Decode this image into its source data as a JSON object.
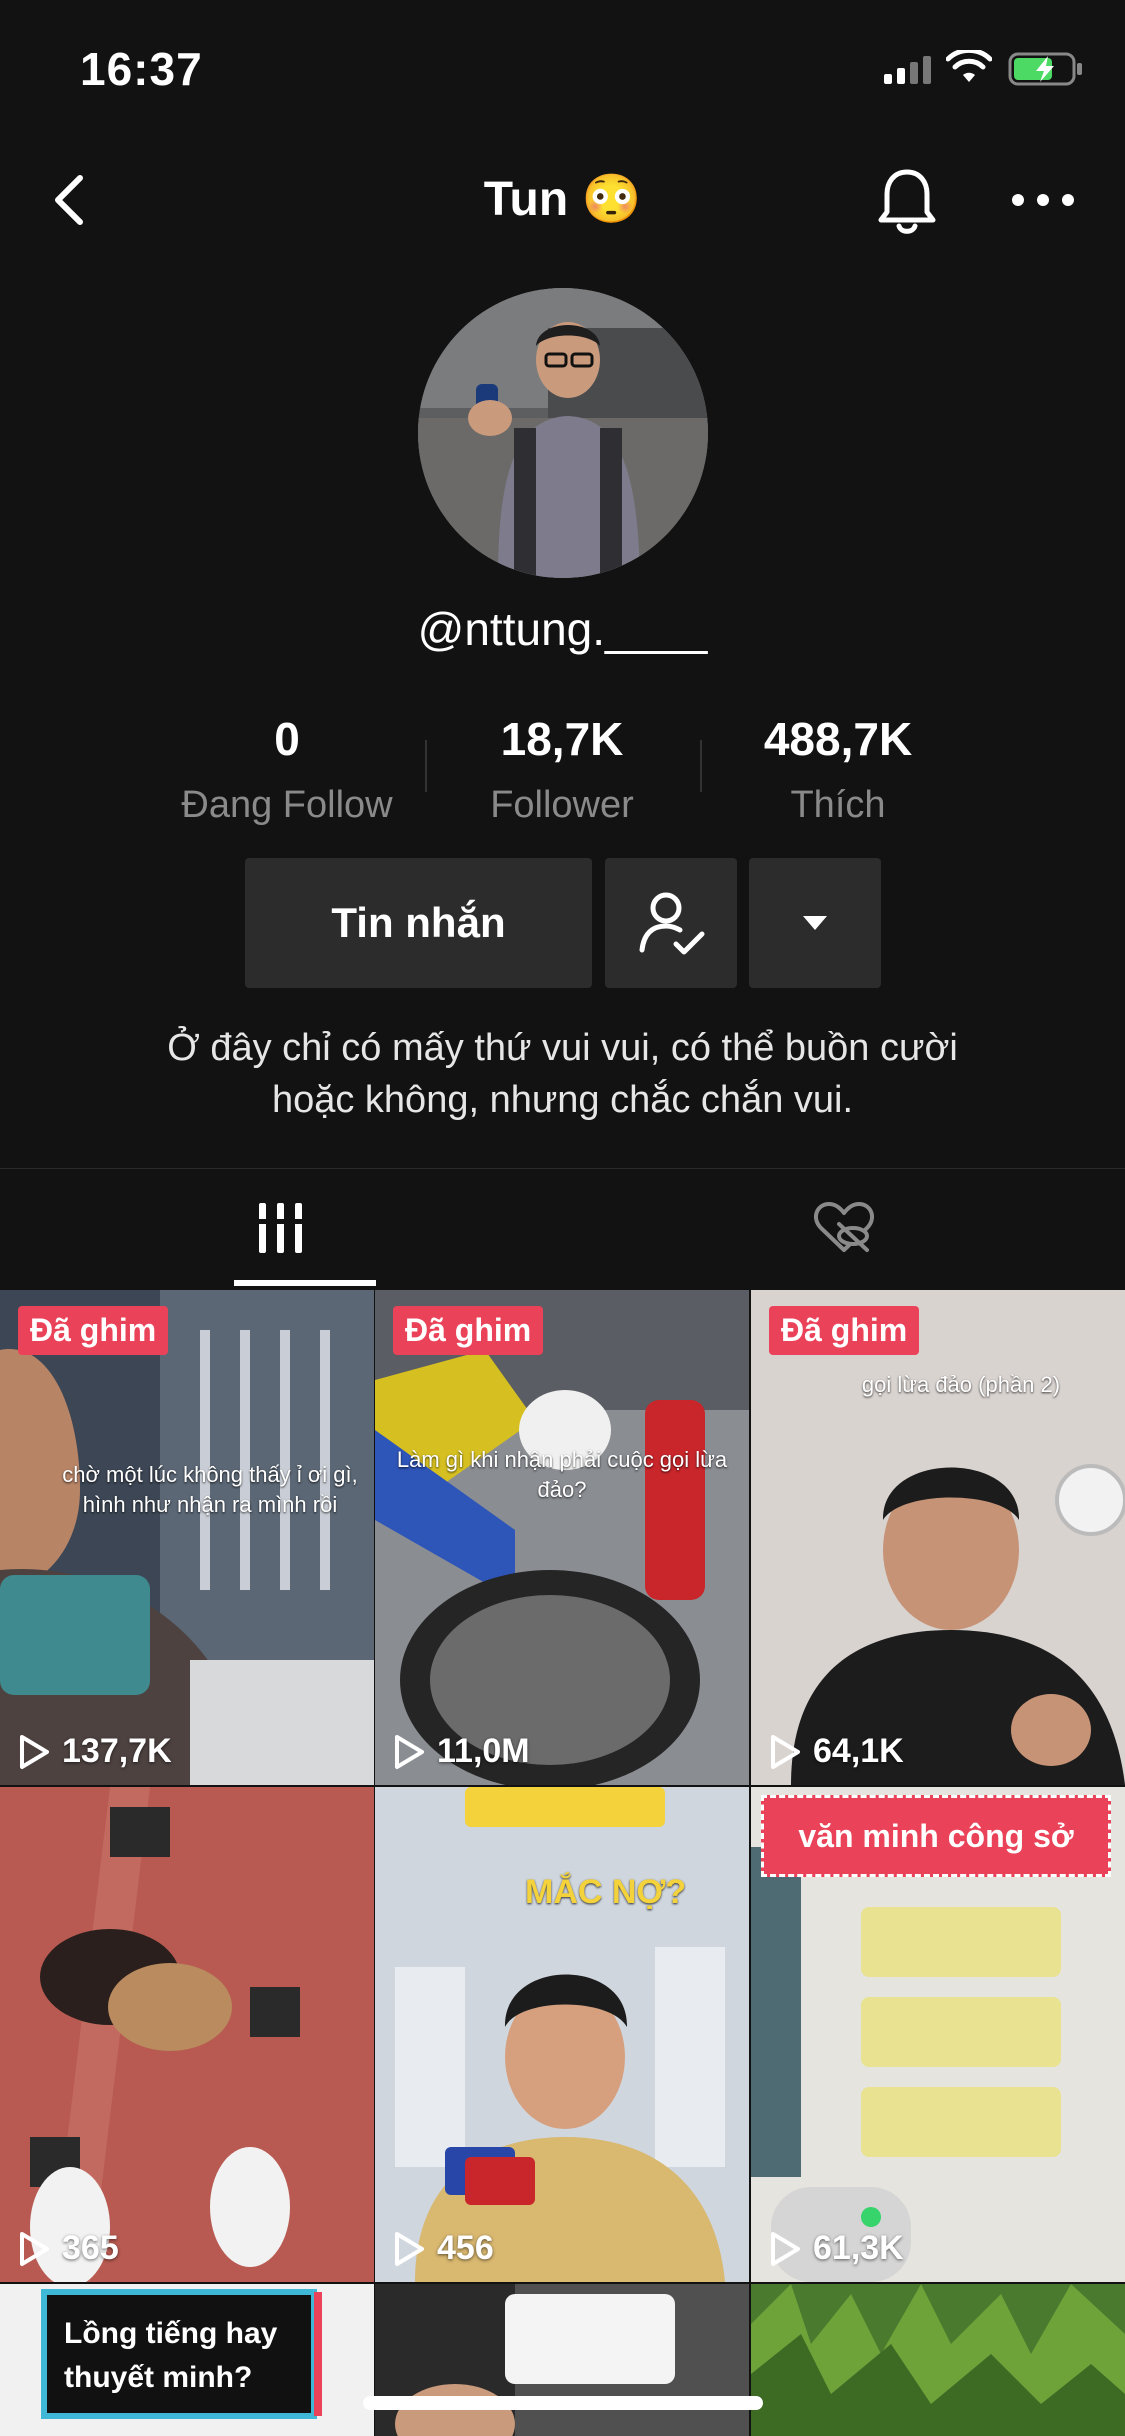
{
  "status_bar": {
    "time": "16:37"
  },
  "header": {
    "title": "Tun 😳"
  },
  "profile": {
    "handle": "@nttung.____",
    "stats": [
      {
        "value": "0",
        "label": "Đang Follow"
      },
      {
        "value": "18,7K",
        "label": "Follower"
      },
      {
        "value": "488,7K",
        "label": "Thích"
      }
    ],
    "message_button": "Tin nhắn",
    "bio_line1": "Ở đây chỉ có mấy thứ vui vui, có thể buồn cười",
    "bio_line2": "hoặc không, nhưng chắc chắn vui."
  },
  "videos": [
    {
      "pinned": "Đã ghim",
      "views": "137,7K",
      "caption": "chờ một lúc không thấy ỉ ơi gì, hình như nhận ra mình rồi"
    },
    {
      "pinned": "Đã ghim",
      "views": "11,0M",
      "caption": "Làm gì khi nhận phải cuộc gọi lừa đảo?"
    },
    {
      "pinned": "Đã ghim",
      "views": "64,1K",
      "caption": "gọi lừa đảo (phần 2)"
    },
    {
      "pinned": "",
      "views": "365",
      "caption": ""
    },
    {
      "pinned": "",
      "views": "456",
      "caption": "MẮC NỢ?"
    },
    {
      "pinned": "",
      "views": "61,3K",
      "caption": "văn minh công sở"
    },
    {
      "pinned": "",
      "views": "",
      "caption": "Lồng tiếng hay thuyết minh?"
    },
    {
      "pinned": "",
      "views": "",
      "caption": ""
    },
    {
      "pinned": "",
      "views": "",
      "caption": ""
    }
  ],
  "colors": {
    "background": "#121212",
    "pinned_badge": "#ea4359",
    "button_bg": "#2c2c2c"
  }
}
